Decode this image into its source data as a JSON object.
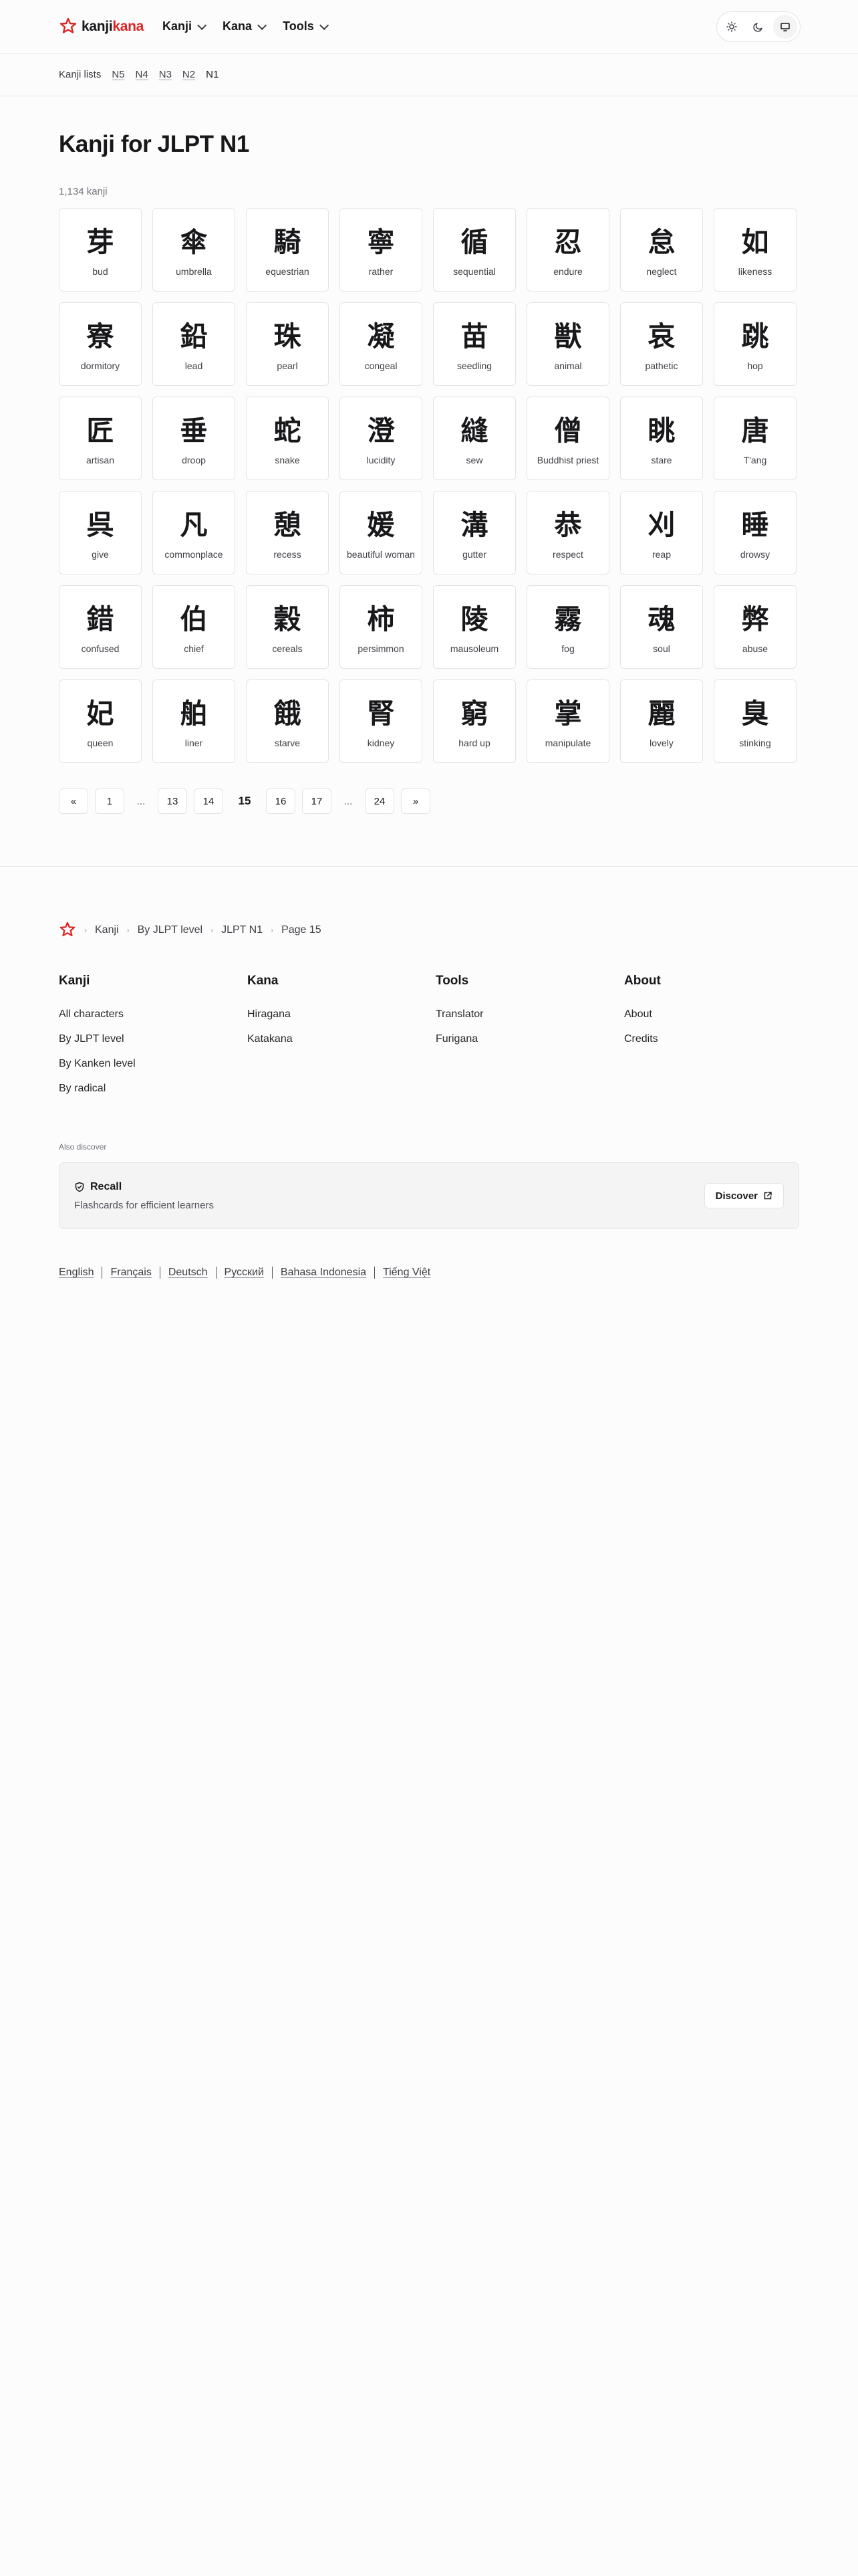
{
  "header": {
    "logo_part1": "kanji",
    "logo_part2": "kana",
    "nav": [
      {
        "label": "Kanji"
      },
      {
        "label": "Kana"
      },
      {
        "label": "Tools"
      }
    ],
    "theme_icons": {
      "light": "sun-icon",
      "dark": "moon-icon",
      "system": "monitor-icon"
    }
  },
  "subnav": {
    "label": "Kanji lists",
    "levels": [
      "N5",
      "N4",
      "N3",
      "N2"
    ],
    "current": "N1"
  },
  "page": {
    "title": "Kanji for JLPT N1",
    "count": "1,134 kanji"
  },
  "kanji": [
    {
      "k": "芽",
      "m": "bud"
    },
    {
      "k": "傘",
      "m": "umbrella"
    },
    {
      "k": "騎",
      "m": "equestrian"
    },
    {
      "k": "寧",
      "m": "rather"
    },
    {
      "k": "循",
      "m": "sequential"
    },
    {
      "k": "忍",
      "m": "endure"
    },
    {
      "k": "怠",
      "m": "neglect"
    },
    {
      "k": "如",
      "m": "likeness"
    },
    {
      "k": "寮",
      "m": "dormitory"
    },
    {
      "k": "鉛",
      "m": "lead"
    },
    {
      "k": "珠",
      "m": "pearl"
    },
    {
      "k": "凝",
      "m": "congeal"
    },
    {
      "k": "苗",
      "m": "seedling"
    },
    {
      "k": "獣",
      "m": "animal"
    },
    {
      "k": "哀",
      "m": "pathetic"
    },
    {
      "k": "跳",
      "m": "hop"
    },
    {
      "k": "匠",
      "m": "artisan"
    },
    {
      "k": "垂",
      "m": "droop"
    },
    {
      "k": "蛇",
      "m": "snake"
    },
    {
      "k": "澄",
      "m": "lucidity"
    },
    {
      "k": "縫",
      "m": "sew"
    },
    {
      "k": "僧",
      "m": "Buddhist priest"
    },
    {
      "k": "眺",
      "m": "stare"
    },
    {
      "k": "唐",
      "m": "T'ang"
    },
    {
      "k": "呉",
      "m": "give"
    },
    {
      "k": "凡",
      "m": "commonplace"
    },
    {
      "k": "憩",
      "m": "recess"
    },
    {
      "k": "媛",
      "m": "beautiful woman"
    },
    {
      "k": "溝",
      "m": "gutter"
    },
    {
      "k": "恭",
      "m": "respect"
    },
    {
      "k": "刈",
      "m": "reap"
    },
    {
      "k": "睡",
      "m": "drowsy"
    },
    {
      "k": "錯",
      "m": "confused"
    },
    {
      "k": "伯",
      "m": "chief"
    },
    {
      "k": "穀",
      "m": "cereals"
    },
    {
      "k": "柿",
      "m": "persimmon"
    },
    {
      "k": "陵",
      "m": "mausoleum"
    },
    {
      "k": "霧",
      "m": "fog"
    },
    {
      "k": "魂",
      "m": "soul"
    },
    {
      "k": "弊",
      "m": "abuse"
    },
    {
      "k": "妃",
      "m": "queen"
    },
    {
      "k": "舶",
      "m": "liner"
    },
    {
      "k": "餓",
      "m": "starve"
    },
    {
      "k": "腎",
      "m": "kidney"
    },
    {
      "k": "窮",
      "m": "hard up"
    },
    {
      "k": "掌",
      "m": "manipulate"
    },
    {
      "k": "麗",
      "m": "lovely"
    },
    {
      "k": "臭",
      "m": "stinking"
    }
  ],
  "pagination": {
    "prev": "«",
    "first": "1",
    "ellipsis": "...",
    "p13": "13",
    "p14": "14",
    "current": "15",
    "p16": "16",
    "p17": "17",
    "last": "24",
    "next": "»"
  },
  "footer": {
    "breadcrumb": [
      "Kanji",
      "By JLPT level",
      "JLPT N1",
      "Page 15"
    ],
    "columns": [
      {
        "title": "Kanji",
        "links": [
          "All characters",
          "By JLPT level",
          "By Kanken level",
          "By radical"
        ]
      },
      {
        "title": "Kana",
        "links": [
          "Hiragana",
          "Katakana"
        ]
      },
      {
        "title": "Tools",
        "links": [
          "Translator",
          "Furigana"
        ]
      },
      {
        "title": "About",
        "links": [
          "About",
          "Credits"
        ]
      }
    ],
    "also_discover": "Also discover",
    "recall": {
      "title": "Recall",
      "subtitle": "Flashcards for efficient learners",
      "button": "Discover"
    },
    "languages": [
      "English",
      "Français",
      "Deutsch",
      "Русский",
      "Bahasa Indonesia",
      "Tiếng Việt"
    ]
  },
  "colors": {
    "accent": "#dc2626",
    "border": "#e4e4e7",
    "background": "#fcfcfc"
  }
}
